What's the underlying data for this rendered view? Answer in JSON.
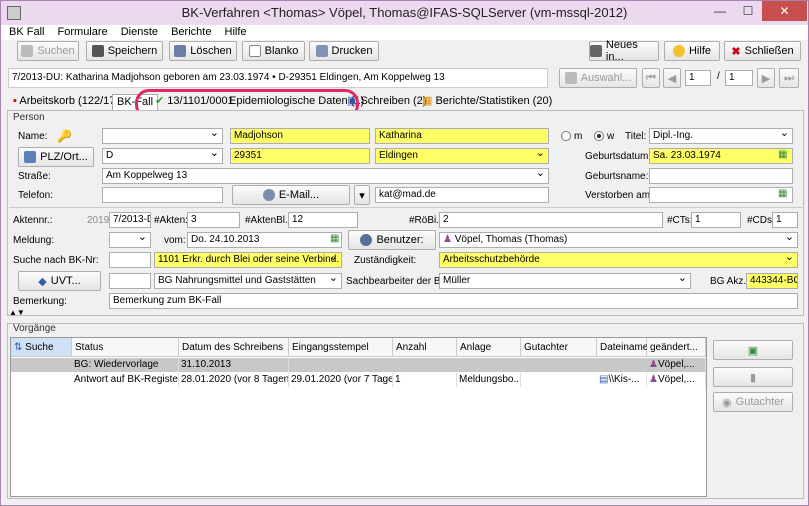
{
  "window": {
    "title": "BK-Verfahren <Thomas> Vöpel, Thomas@IFAS-SQLServer (vm-mssql-2012)",
    "min": "—",
    "max": "☐",
    "close": "✕"
  },
  "menu": [
    "BK Fall",
    "Formulare",
    "Dienste",
    "Berichte",
    "Hilfe"
  ],
  "toolbar": {
    "suchen": "Suchen",
    "speichern": "Speichern",
    "loeschen": "Löschen",
    "blanko": "Blanko",
    "drucken": "Drucken",
    "neues": "Neues in...",
    "hilfe": "Hilfe",
    "schliessen": "Schließen"
  },
  "info": "7/2013-DU: Katharina Madjohson geboren am 23.03.1974 • D-29351 Eldingen, Am Koppelweg 13",
  "nav": {
    "auswahl": "Auswahl...",
    "page": "1",
    "sep": "/",
    "total": "1"
  },
  "tabs": [
    "Arbeitskorb (122/17)",
    "BK-Fall",
    "13/1101/0001",
    "Epidemiologische Daten (1)",
    "Schreiben (2)",
    "Berichte/Statistiken (20)"
  ],
  "person": {
    "section": "Person",
    "name_lbl": "Name:",
    "plz_btn": "PLZ/Ort...",
    "nachname": "Madjohson",
    "vorname": "Katharina",
    "land": "D",
    "plz": "29351",
    "ort": "Eldingen",
    "m": "m",
    "w": "w",
    "titel_lbl": "Titel:",
    "titel": "Dipl.-Ing.",
    "geb_lbl": "Geburtsdatum:",
    "geb": "Sa. 23.03.1974",
    "strasse_lbl": "Straße:",
    "strasse": "Am Koppelweg 13",
    "gebname_lbl": "Geburtsname:",
    "telefon_lbl": "Telefon:",
    "email_btn": "E-Mail...",
    "email": "kat@mad.de",
    "verst_lbl": "Verstorben am:"
  },
  "akte": {
    "aktennr_lbl": "Aktennr.:",
    "jahr": "2019",
    "aktennr": "7/2013-D",
    "akten_lbl": "#Akten:",
    "akten": "3",
    "aktenbl_lbl": "#AktenBl.:",
    "aktenbl": "12",
    "roebi_lbl": "#RöBi.:",
    "roebi": "2",
    "cts_lbl": "#CTs:",
    "cts": "1",
    "cds_lbl": "#CDs:",
    "cds": "1",
    "meldung_lbl": "Meldung:",
    "vom_lbl": "vom:",
    "vom": "Do. 24.10.2013",
    "benutzer_btn": "Benutzer:",
    "benutzer": "Vöpel, Thomas (Thomas)",
    "suche_lbl": "Suche nach BK-Nr:",
    "bk": "1101 Erkr. durch Blei oder seine Verbind.",
    "zust_lbl": "Zuständigkeit:",
    "zust": "Arbeitsschutzbehörde",
    "uvt_btn": "UVT...",
    "uvt": "BG Nahrungsmittel und Gaststätten",
    "sachb_lbl": "Sachbearbeiter der BG:",
    "sachb": "Müller",
    "akz_lbl": "BG Akz.:",
    "akz": "443344-BG",
    "bem_lbl": "Bemerkung:",
    "bem": "Bemerkung zum BK-Fall"
  },
  "vorgaenge": {
    "section": "Vorgänge",
    "headers": [
      "Suche",
      "Status",
      "Datum des Schreibens",
      "Eingangsstempel",
      "Anzahl",
      "Anlage",
      "Gutachter",
      "Dateiname",
      "geändert..."
    ],
    "rows": [
      [
        "",
        "BG: Wiedervorlage",
        "31.10.2013",
        "",
        "",
        "",
        "",
        "",
        "Vöpel,..."
      ],
      [
        "",
        "Antwort auf BK-Register",
        "28.01.2020 (vor 8 Tagen)",
        "29.01.2020 (vor 7 Tagen)",
        "1",
        "Meldungsbo...",
        "",
        "\\\\Kis-...",
        "Vöpel,..."
      ]
    ],
    "gutachter_btn": "Gutachter"
  }
}
